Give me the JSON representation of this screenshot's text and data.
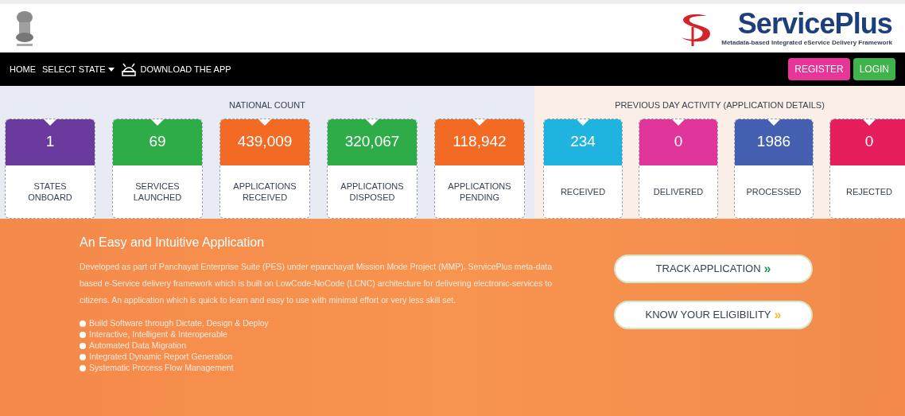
{
  "header": {
    "logo": {
      "name": "ServicePlus",
      "tagline": "Metadata-based Integrated eService Delivery Framework"
    }
  },
  "nav": {
    "items": [
      "HOME",
      "SELECT STATE",
      "DOWNLOAD THE APP"
    ],
    "buttons": [
      {
        "label": "REGISTER",
        "color": "#e8359a"
      },
      {
        "label": "LOGIN",
        "color": "#3fb44a"
      }
    ]
  },
  "national_count": {
    "title": "NATIONAL COUNT",
    "cards": [
      {
        "value": "1",
        "label": "STATES ONBOARD",
        "color": "#6a3a9e"
      },
      {
        "value": "69",
        "label": "SERVICES LAUNCHED",
        "color": "#2eac48"
      },
      {
        "value": "439,009",
        "label": "APPLICATIONS RECEIVED",
        "color": "#f26a23"
      },
      {
        "value": "320,067",
        "label": "APPLICATIONS DISPOSED",
        "color": "#2eac48"
      },
      {
        "value": "118,942",
        "label": "APPLICATIONS PENDING",
        "color": "#f26a23"
      }
    ]
  },
  "previous_day": {
    "title": "PREVIOUS DAY ACTIVITY (APPLICATION DETAILS)",
    "cards": [
      {
        "value": "234",
        "label": "RECEIVED",
        "color": "#1fb3e0"
      },
      {
        "value": "0",
        "label": "DELIVERED",
        "color": "#e0359a"
      },
      {
        "value": "1986",
        "label": "PROCESSED",
        "color": "#4560b0"
      },
      {
        "value": "0",
        "label": "REJECTED",
        "color": "#e61e5c"
      }
    ]
  },
  "intro": {
    "heading": "An Easy and Intuitive Application",
    "paragraph": "Developed as part of Panchayat Enterprise Suite (PES) under epanchayat Mission Mode Project (MMP). ServicePlus meta-data based e-Service delivery framework which is built on LowCode-NoCode (LCNC) architecture for delivering electronic-services to citizens. An application which is quick to learn and easy to use with minimal effort or very less skill set.",
    "features": [
      "Build Software through Dictate, Design & Deploy",
      "Interactive, Intelligent & Interoperable",
      "Automated Data Migration",
      "Integrated Dynamic Report Generation",
      "Systematic Process Flow Management"
    ]
  },
  "actions": [
    {
      "label": "TRACK APPLICATION",
      "arrow": "»",
      "color": "#1f9a55"
    },
    {
      "label": "KNOW YOUR ELIGIBILITY",
      "arrow": "»",
      "color": "#f2c12e"
    }
  ]
}
